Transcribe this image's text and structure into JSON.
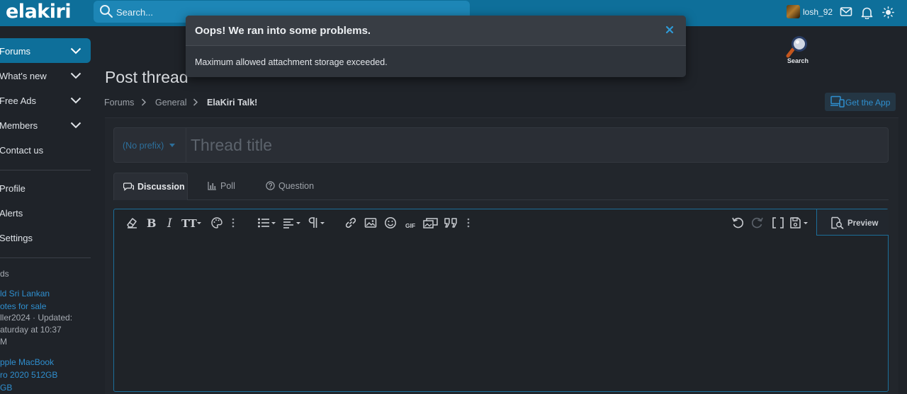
{
  "header": {
    "logo": "elakiri",
    "search_placeholder": "Search...",
    "username": "losh_92"
  },
  "sidebar": {
    "items": [
      {
        "label": "Forums"
      },
      {
        "label": "What's new"
      },
      {
        "label": "Free Ads"
      },
      {
        "label": "Members"
      },
      {
        "label": "Contact us"
      }
    ],
    "account_items": [
      {
        "label": "Profile"
      },
      {
        "label": "Alerts"
      },
      {
        "label": "Settings"
      }
    ],
    "ads_heading": "ds",
    "ads": [
      {
        "title_line1": "ld Sri Lankan",
        "title_line2": "otes for sale",
        "meta1": "ller2024 · Updated:",
        "meta2": "aturday at 10:37",
        "meta3": "M"
      },
      {
        "title_line1": "pple MacBook",
        "title_line2": "ro 2020 512GB",
        "title_line3": "GB"
      }
    ]
  },
  "search_widget": {
    "label": "Search"
  },
  "main": {
    "page_title": "Post thread",
    "breadcrumbs": [
      "Forums",
      "General",
      "ElaKiri Talk!"
    ],
    "get_app": "Get the App",
    "prefix": "(No prefix)",
    "title_placeholder": "Thread title",
    "tabs": [
      {
        "label": "Discussion",
        "icon": "chat-icon"
      },
      {
        "label": "Poll",
        "icon": "bar-chart-icon"
      },
      {
        "label": "Question",
        "icon": "question-circle-icon"
      }
    ],
    "preview_label": "Preview",
    "gif_label": "GIF"
  },
  "modal": {
    "title": "Oops! We ran into some problems.",
    "message": "Maximum allowed attachment storage exceeded."
  },
  "colors": {
    "accent": "#0e6f9a",
    "link": "#2f8fcf",
    "background": "#1f2329"
  }
}
